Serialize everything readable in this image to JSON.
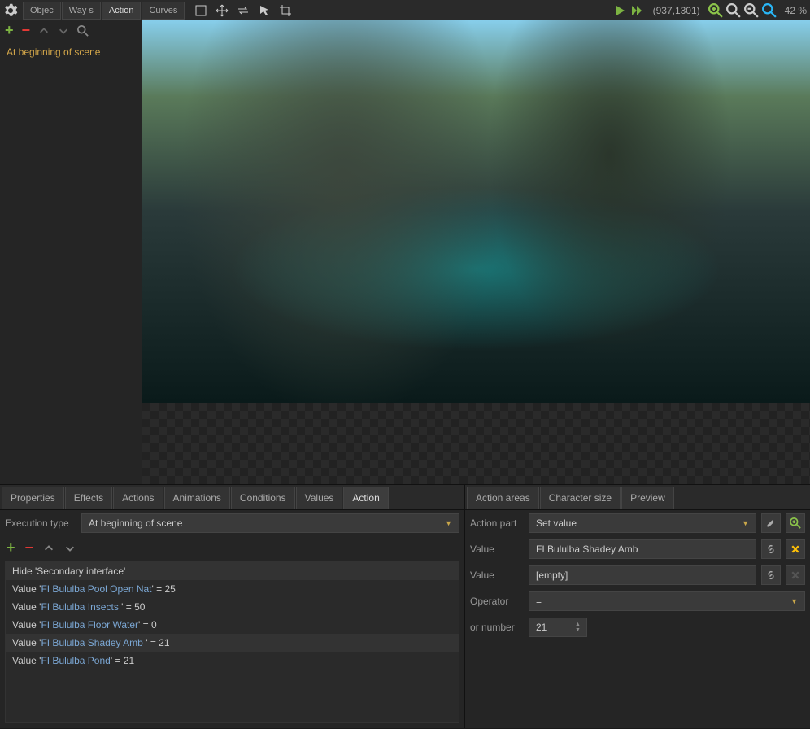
{
  "toolbar": {
    "modes": [
      "Objec",
      "Way s",
      "Action",
      "Curves"
    ],
    "active_mode": 2,
    "coords": "(937,1301)",
    "zoom_pct": "42 %"
  },
  "sidebar": {
    "items": [
      "At beginning of scene"
    ]
  },
  "tabs_left": {
    "items": [
      "Properties",
      "Effects",
      "Actions",
      "Animations",
      "Conditions",
      "Values",
      "Action"
    ],
    "active": 6
  },
  "tabs_right": {
    "items": [
      "Action areas",
      "Character size",
      "Preview"
    ]
  },
  "exec": {
    "label": "Execution type",
    "value": "At beginning of scene"
  },
  "actions": {
    "header": "Hide 'Secondary interface'",
    "rows": [
      {
        "pre": "Value '",
        "link": "FI Bululba Pool Open Nat",
        "post": "' = 25"
      },
      {
        "pre": "Value '",
        "link": "FI Bululba Insects ",
        "post": "' = 50"
      },
      {
        "pre": "Value '",
        "link": "FI Bululba Floor Water",
        "post": "' = 0"
      },
      {
        "pre": "Value '",
        "link": "FI Bululba Shadey Amb ",
        "post": "' = 21"
      },
      {
        "pre": "Value '",
        "link": "FI Bululba Pond",
        "post": "' = 21"
      }
    ]
  },
  "right": {
    "action_part_label": "Action part",
    "action_part_value": "Set value",
    "value1_label": "Value",
    "value1": "FI Bululba Shadey Amb",
    "value2_label": "Value",
    "value2": "[empty]",
    "operator_label": "Operator",
    "operator_value": "=",
    "number_label": "or number",
    "number_value": "21"
  }
}
